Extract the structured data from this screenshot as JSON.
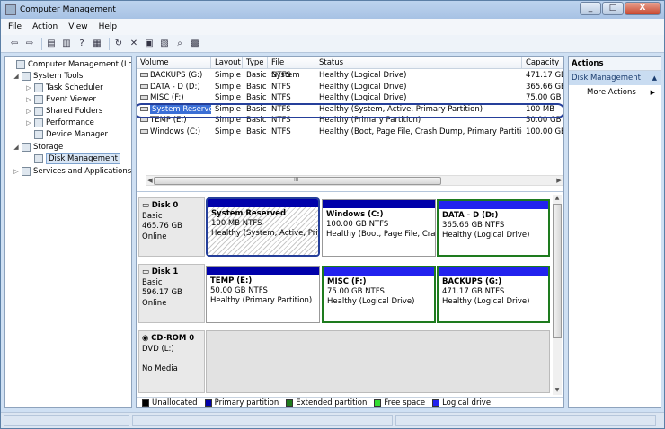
{
  "window": {
    "title": "Computer Management",
    "btn_min": "_",
    "btn_max": "□",
    "btn_close": "X"
  },
  "menu": [
    "File",
    "Action",
    "View",
    "Help"
  ],
  "tree": [
    {
      "label": "Computer Management (Local",
      "icon": "computer-icon",
      "arrow": "",
      "level": 0
    },
    {
      "label": "System Tools",
      "icon": "tools-icon",
      "arrow": "◢",
      "level": 1
    },
    {
      "label": "Task Scheduler",
      "icon": "clock-icon",
      "arrow": "▷",
      "level": 2
    },
    {
      "label": "Event Viewer",
      "icon": "event-icon",
      "arrow": "▷",
      "level": 2
    },
    {
      "label": "Shared Folders",
      "icon": "folder-icon",
      "arrow": "▷",
      "level": 2
    },
    {
      "label": "Performance",
      "icon": "chart-icon",
      "arrow": "▷",
      "level": 2
    },
    {
      "label": "Device Manager",
      "icon": "device-icon",
      "arrow": "",
      "level": 2
    },
    {
      "label": "Storage",
      "icon": "storage-icon",
      "arrow": "◢",
      "level": 1
    },
    {
      "label": "Disk Management",
      "icon": "disk-icon",
      "arrow": "",
      "level": 2,
      "selected": true
    },
    {
      "label": "Services and Applications",
      "icon": "services-icon",
      "arrow": "▷",
      "level": 1
    }
  ],
  "volumes": {
    "headers": [
      "Volume",
      "Layout",
      "Type",
      "File System",
      "Status",
      "Capacity"
    ],
    "rows": [
      [
        "BACKUPS (G:)",
        "Simple",
        "Basic",
        "NTFS",
        "Healthy (Logical Drive)",
        "471.17 GB"
      ],
      [
        "DATA - D (D:)",
        "Simple",
        "Basic",
        "NTFS",
        "Healthy (Logical Drive)",
        "365.66 GB"
      ],
      [
        "MISC (F:)",
        "Simple",
        "Basic",
        "NTFS",
        "Healthy (Logical Drive)",
        "75.00 GB"
      ],
      [
        "System Reserved",
        "Simple",
        "Basic",
        "NTFS",
        "Healthy (System, Active, Primary Partition)",
        "100 MB"
      ],
      [
        "TEMP (E:)",
        "Simple",
        "Basic",
        "NTFS",
        "Healthy (Primary Partition)",
        "50.00 GB"
      ],
      [
        "Windows (C:)",
        "Simple",
        "Basic",
        "NTFS",
        "Healthy (Boot, Page File, Crash Dump, Primary Partition)",
        "100.00 GB"
      ]
    ],
    "selected_row": 3,
    "scroll_grip": "III"
  },
  "disks": [
    {
      "name": "Disk 0",
      "type": "Basic",
      "size": "465.76 GB",
      "state": "Online",
      "partitions": [
        {
          "name": "System Reserved",
          "size": "100 MB NTFS",
          "status": "Healthy (System, Active, Prim"
        },
        {
          "name": "Windows  (C:)",
          "size": "100.00 GB NTFS",
          "status": "Healthy (Boot, Page File, Crasl"
        },
        {
          "name": "DATA - D  (D:)",
          "size": "365.66 GB NTFS",
          "status": "Healthy (Logical Drive)"
        }
      ]
    },
    {
      "name": "Disk 1",
      "type": "Basic",
      "size": "596.17 GB",
      "state": "Online",
      "partitions": [
        {
          "name": "TEMP  (E:)",
          "size": "50.00 GB NTFS",
          "status": "Healthy (Primary Partition)"
        },
        {
          "name": "MISC  (F:)",
          "size": "75.00 GB NTFS",
          "status": "Healthy (Logical Drive)"
        },
        {
          "name": "BACKUPS  (G:)",
          "size": "471.17 GB NTFS",
          "status": "Healthy (Logical Drive)"
        }
      ]
    },
    {
      "name": "CD-ROM 0",
      "type": "DVD (L:)",
      "size": "",
      "state": "No Media",
      "partitions": []
    }
  ],
  "legend": [
    {
      "label": "Unallocated",
      "color": "#000000"
    },
    {
      "label": "Primary partition",
      "color": "#0000aa"
    },
    {
      "label": "Extended partition",
      "color": "#1e7b1e"
    },
    {
      "label": "Free space",
      "color": "#33dd33"
    },
    {
      "label": "Logical drive",
      "color": "#2222ee"
    }
  ],
  "actions": {
    "header": "Actions",
    "section": "Disk Management",
    "more": "More Actions"
  }
}
